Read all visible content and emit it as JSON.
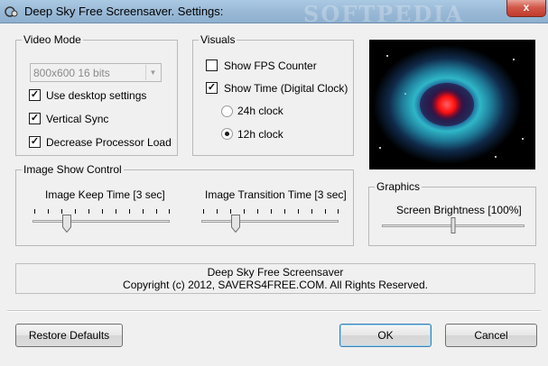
{
  "window": {
    "title": "Deep Sky Free Screensaver. Settings:",
    "watermark": "SOFTPEDIA",
    "close_glyph": "x"
  },
  "video_mode": {
    "label": "Video Mode",
    "resolution_value": "800x600 16 bits",
    "use_desktop_settings": {
      "label": "Use desktop settings",
      "checked": true
    },
    "vertical_sync": {
      "label": "Vertical Sync",
      "checked": true
    },
    "decrease_processor_load": {
      "label": "Decrease Processor Load",
      "checked": true
    }
  },
  "visuals": {
    "label": "Visuals",
    "show_fps": {
      "label": "Show FPS Counter",
      "checked": false
    },
    "show_time": {
      "label": "Show Time (Digital Clock)",
      "checked": true
    },
    "clock_24h": {
      "label": "24h clock",
      "selected": false
    },
    "clock_12h": {
      "label": "12h clock",
      "selected": true
    }
  },
  "image_show_control": {
    "label": "Image Show Control",
    "keep_time": {
      "label": "Image Keep Time [3 sec]",
      "level": 0.25
    },
    "transition_time": {
      "label": "Image Transition Time [3 sec]",
      "level": 0.25
    }
  },
  "graphics": {
    "label": "Graphics",
    "brightness": {
      "label": "Screen Brightness [100%]",
      "level": 0.5
    }
  },
  "info": {
    "line1": "Deep Sky Free Screensaver",
    "line2": "Copyright (c) 2012, SAVERS4FREE.COM. All Rights Reserved."
  },
  "buttons": {
    "restore_defaults": "Restore Defaults",
    "ok": "OK",
    "cancel": "Cancel"
  },
  "preview": {
    "icon": "helix-nebula-image"
  },
  "colors": {
    "title_bar": "#9ab9d6",
    "close_button": "#c0392b",
    "nebula_core": "#ff1a1a",
    "nebula_ring": "#2fb7c7"
  }
}
